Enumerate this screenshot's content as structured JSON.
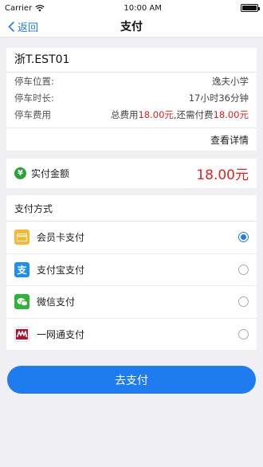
{
  "status_bar": {
    "carrier": "Carrier",
    "time": "10:00 AM",
    "battery_level": 1.0
  },
  "nav": {
    "back_label": "返回",
    "title": "支付"
  },
  "parking": {
    "plate": "浙T.EST01",
    "location_label": "停车位置:",
    "location_value": "逸夫小学",
    "duration_label": "停车时长:",
    "duration_value": "17小时36分钟",
    "fee_label": "停车费用",
    "fee_total_prefix": "总费用",
    "fee_total": "18.00元",
    "fee_due_prefix": ",还需付费",
    "fee_due": "18.00元",
    "details_label": "查看详情"
  },
  "amount": {
    "icon": "yen-icon",
    "icon_glyph": "¥",
    "label": "实付金额",
    "value": "18.00元"
  },
  "payment_methods": {
    "header": "支付方式",
    "items": [
      {
        "label": "会员卡支付",
        "icon": "member-card-icon",
        "selected": true
      },
      {
        "label": "支付宝支付",
        "icon": "alipay-icon",
        "icon_glyph": "支",
        "selected": false
      },
      {
        "label": "微信支付",
        "icon": "wechat-icon",
        "selected": false
      },
      {
        "label": "一网通支付",
        "icon": "ywt-icon",
        "selected": false
      }
    ]
  },
  "pay_button": {
    "label": "去支付"
  },
  "colors": {
    "accent": "#1E7BF0",
    "price_red": "#E62020",
    "yen_green": "#2AA334",
    "background": "#EFEFF4"
  }
}
